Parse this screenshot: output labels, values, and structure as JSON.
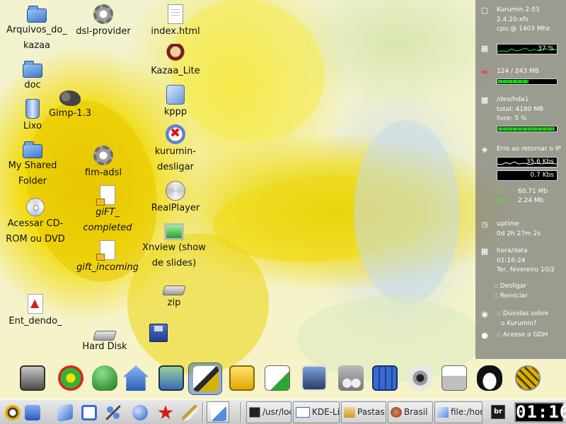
{
  "desktop": {
    "icons": [
      {
        "id": "arquivos-kazaa",
        "label": "Arquivos_do_\nkazaa",
        "icon": "folder-icon"
      },
      {
        "id": "dsl-provider",
        "label": "dsl-provider",
        "icon": "gear-icon"
      },
      {
        "id": "index-html",
        "label": "index.html",
        "icon": "html-page-icon"
      },
      {
        "id": "doc",
        "label": "doc",
        "icon": "folder-icon"
      },
      {
        "id": "kazaa-lite",
        "label": "Kazaa_Lite",
        "icon": "kazaa-icon"
      },
      {
        "id": "gimp",
        "label": "Gimp-1.3",
        "icon": "gimp-icon"
      },
      {
        "id": "lixo",
        "label": "Lixo",
        "icon": "trash-icon"
      },
      {
        "id": "kppp",
        "label": "kppp",
        "icon": "kppp-icon"
      },
      {
        "id": "kurumin-desligar",
        "label": "kurumin-\ndesligar",
        "icon": "shutdown-icon"
      },
      {
        "id": "my-shared-folder",
        "label": "My Shared\nFolder",
        "icon": "folder-icon"
      },
      {
        "id": "fim-adsl",
        "label": "fim-adsl",
        "icon": "gear-icon"
      },
      {
        "id": "acessar-cd",
        "label": "Acessar CD-\nROM ou DVD",
        "icon": "cdrom-icon"
      },
      {
        "id": "gift-completed",
        "label": "giFT_\ncompleted",
        "icon": "locked-file-icon"
      },
      {
        "id": "realplayer",
        "label": "RealPlayer",
        "icon": "realplayer-icon"
      },
      {
        "id": "xnview",
        "label": "Xnview (show\nde slides)",
        "icon": "monitor-icon"
      },
      {
        "id": "gift-incoming",
        "label": "gift_incoming",
        "icon": "locked-file-icon"
      },
      {
        "id": "zip",
        "label": "zip",
        "icon": "drive-icon"
      },
      {
        "id": "entendendo",
        "label": "Ent_dendo_",
        "icon": "pdf-icon"
      },
      {
        "id": "hard-disk",
        "label": "Hard Disk",
        "icon": "hard-disk-icon"
      },
      {
        "id": "floppy",
        "label": "",
        "icon": "floppy-icon"
      }
    ]
  },
  "sysmon": {
    "host": "Kurumin 2.03",
    "kernel": "2.4.20-xfs",
    "cpu": "cpu @ 1403 Mhz",
    "cpu_load": "37 %",
    "cpu_load_value": 0.37,
    "mem": "124 / 243 MB",
    "mem_fraction": 0.51,
    "disk_dev": "/dev/hda1",
    "disk_total": "total: 4180 MB",
    "disk_free": "livre: 5 %",
    "disk_fraction": 0.95,
    "net_error": "Erro ao retornar o IP",
    "net_down": "35.6 Kbs",
    "net_up": "0.7 Kbs",
    "in_label": "in:",
    "in_value": "60.71 Mb",
    "out_label": "out:",
    "out_value": "2.24 Mb",
    "uptime_label": "uptime",
    "uptime_value": "0d 2h 27m 2s",
    "date_label": "hora/data",
    "time_value": "01:16:24",
    "date_value": "Ter, fevereiro 10/2",
    "desligar": ":: Desligar",
    "reiniciar": ":: Reiniciar",
    "duvidas_1": ":: Dúvidas sobre",
    "duvidas_2": "o Kurumin?",
    "gdh": ":: Acesse o GDH"
  },
  "dock": {
    "items": [
      "computer-icon",
      "icq-icon",
      "chat-icon",
      "home-icon",
      "settings-icon",
      "pen-icon",
      "notes-icon",
      "editor-icon",
      "photo-icon",
      "music-icon",
      "calculator-icon",
      "sound-icon",
      "printer-icon",
      "tux-icon",
      "video-icon"
    ]
  },
  "taskbar": {
    "quick": [
      "kmenu-icon",
      "desktop-icon",
      "file-icon",
      "monitor-icon",
      "network-icon",
      "browser-icon",
      "star-icon",
      "knife-icon",
      "active-desktop-icon"
    ],
    "tasks": [
      {
        "label": "/usr/loc",
        "icon": "terminal-icon"
      },
      {
        "label": "KDE-Li",
        "icon": "kde-icon"
      },
      {
        "label": "Pastas",
        "icon": "folder-icon"
      },
      {
        "label": "Brasil",
        "icon": "browser-icon"
      },
      {
        "label": "file:/hor",
        "icon": "file-icon"
      }
    ],
    "tray_text": "br",
    "clock": "01:16"
  },
  "colors": {
    "panel_gray": "#7a7a7a",
    "meter_green": "#19d119",
    "taskbar": "#d6d6d6"
  }
}
